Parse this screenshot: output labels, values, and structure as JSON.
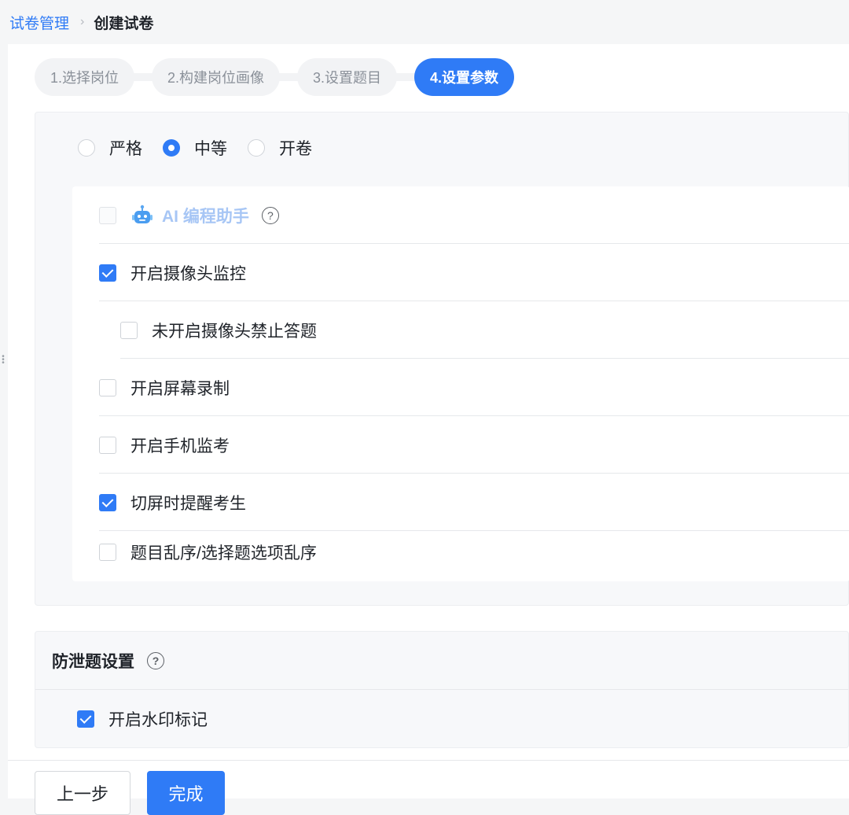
{
  "breadcrumb": {
    "parent": "试卷管理",
    "separator": "›",
    "current": "创建试卷"
  },
  "steps": [
    {
      "label": "1.选择岗位",
      "active": false
    },
    {
      "label": "2.构建岗位画像",
      "active": false
    },
    {
      "label": "3.设置题目",
      "active": false
    },
    {
      "label": "4.设置参数",
      "active": true
    }
  ],
  "strictness": {
    "options": [
      {
        "label": "严格",
        "selected": false
      },
      {
        "label": "中等",
        "selected": true
      },
      {
        "label": "开卷",
        "selected": false
      }
    ]
  },
  "proctoring": {
    "ai_assistant": {
      "label": "AI 编程助手",
      "checked": false,
      "disabled": true,
      "help": "?"
    },
    "items": [
      {
        "label": "开启摄像头监控",
        "checked": true
      },
      {
        "label": "未开启摄像头禁止答题",
        "checked": false
      },
      {
        "label": "开启屏幕录制",
        "checked": false
      },
      {
        "label": "开启手机监考",
        "checked": false
      },
      {
        "label": "切屏时提醒考生",
        "checked": true
      },
      {
        "label": "题目乱序/选择题选项乱序",
        "checked": false
      }
    ]
  },
  "leak_prevention": {
    "title": "防泄题设置",
    "help": "?",
    "watermark": {
      "label": "开启水印标记",
      "checked": true
    }
  },
  "footer": {
    "prev_label": "上一步",
    "done_label": "完成"
  },
  "colors": {
    "accent": "#2f7bf6",
    "ai_text": "#a7c6f5"
  }
}
